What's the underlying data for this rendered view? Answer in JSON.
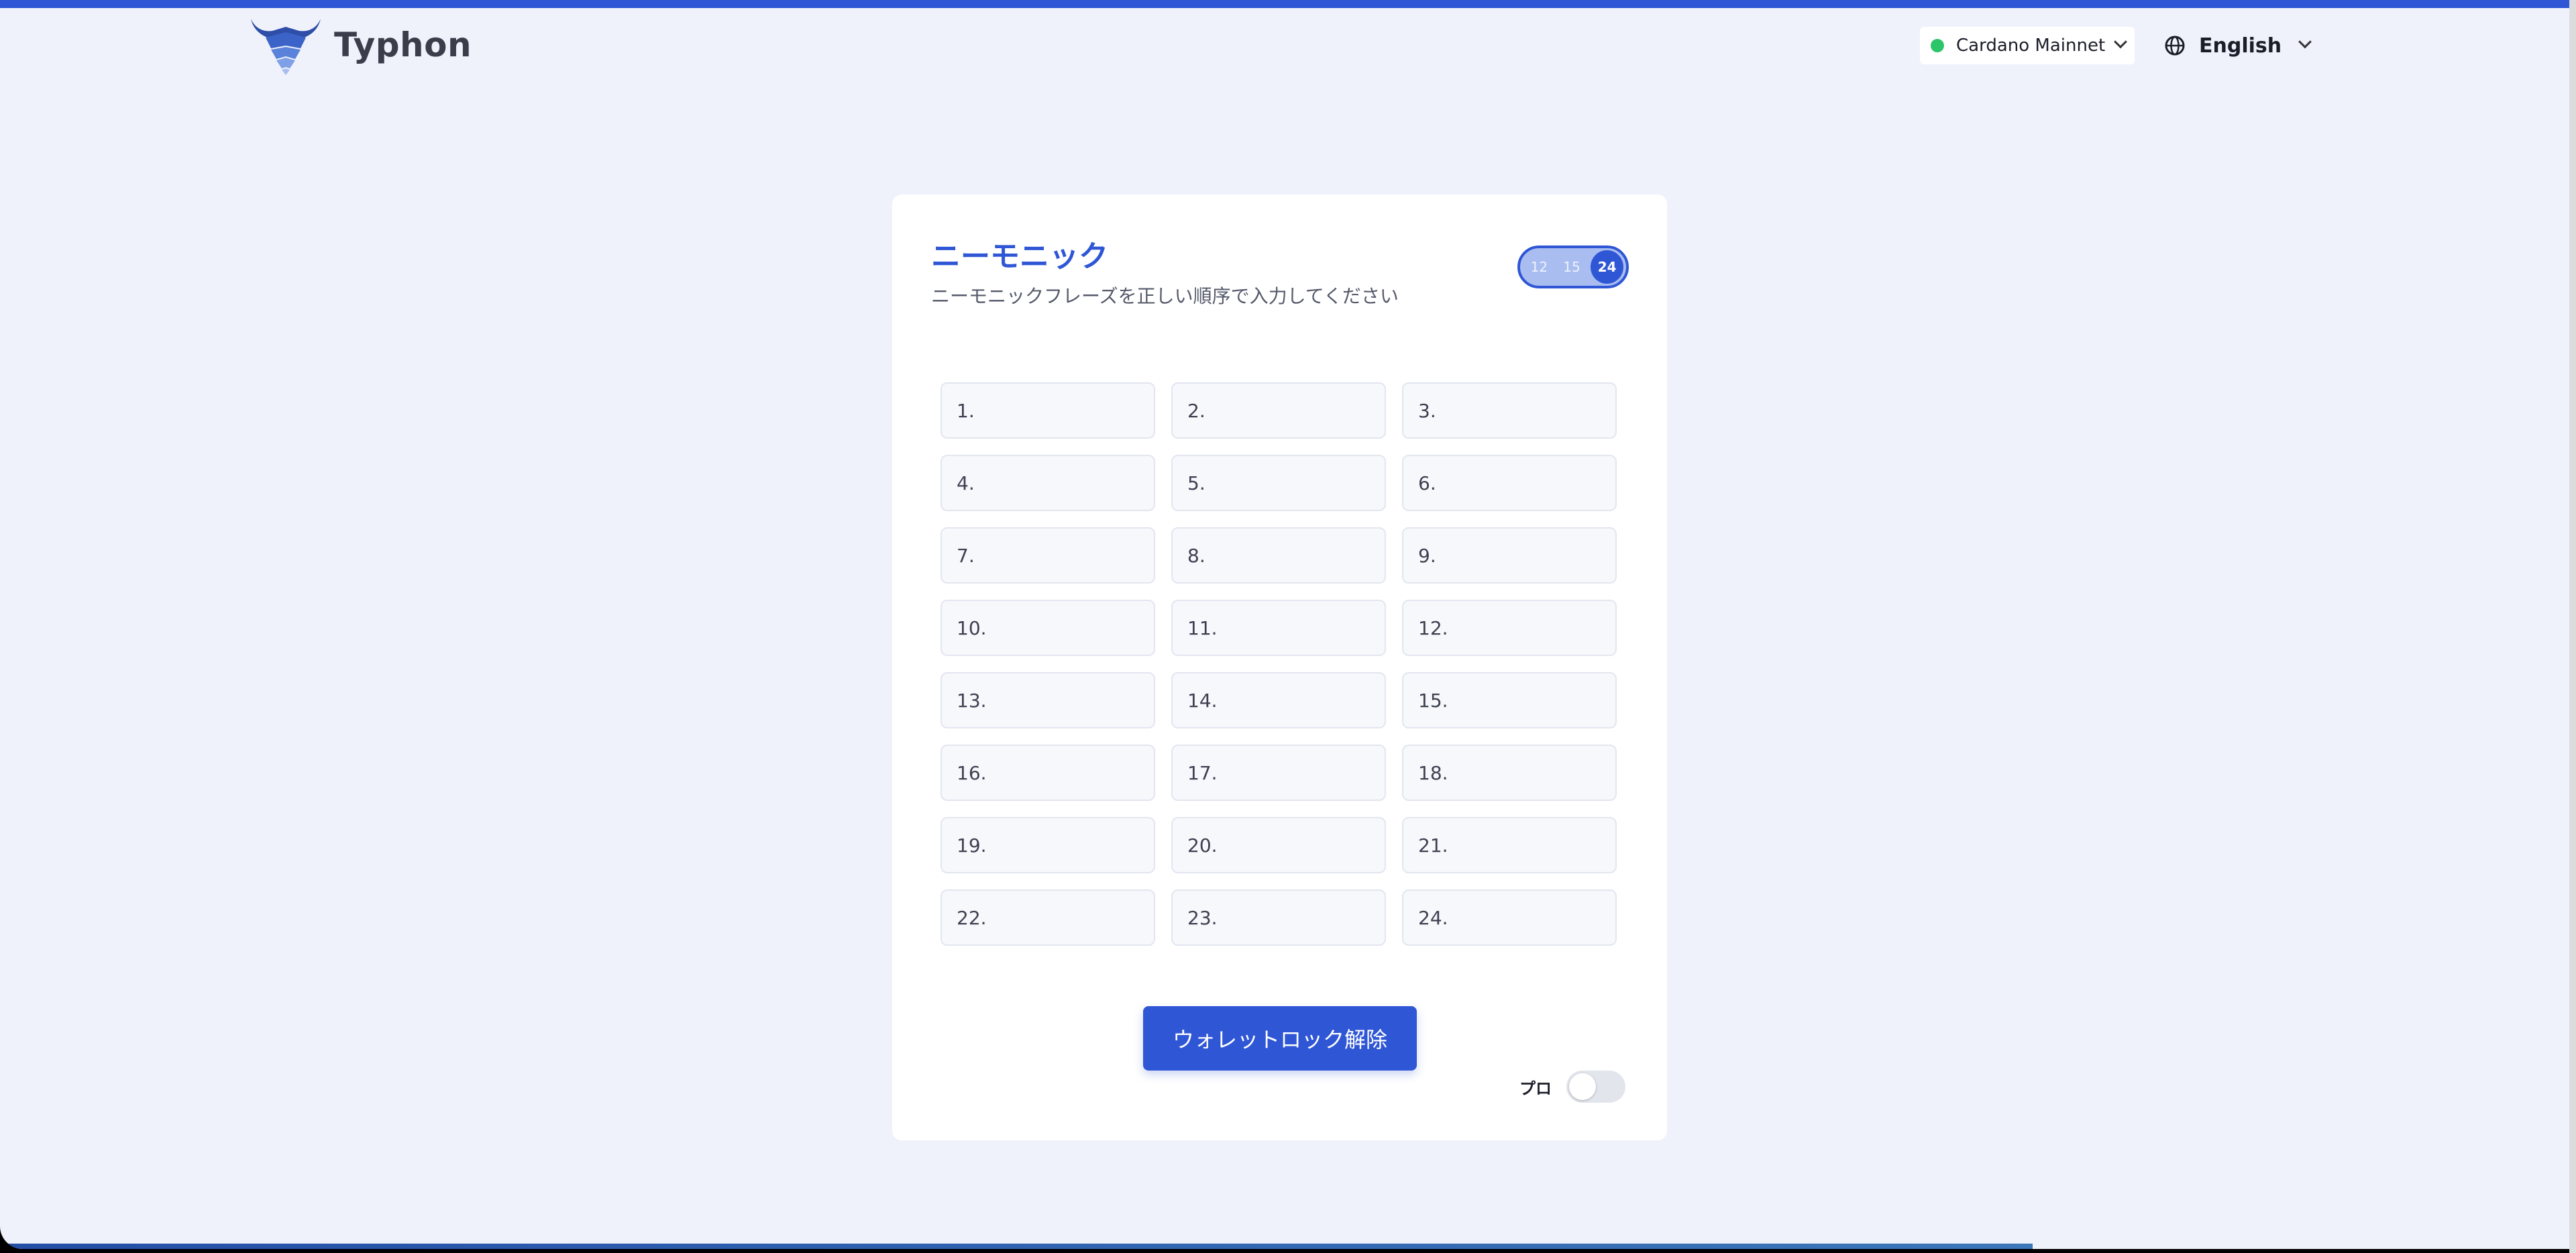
{
  "app": {
    "name": "Typhon"
  },
  "header": {
    "network": {
      "label": "Cardano Mainnet",
      "status_color": "#2dc56a"
    },
    "language": {
      "label": "English"
    }
  },
  "card": {
    "title": "ニーモニック",
    "subtitle": "ニーモニックフレーズを正しい順序で入力してください",
    "word_count_options": [
      "12",
      "15",
      "24"
    ],
    "selected_word_count": "24",
    "words": [
      "1.",
      "2.",
      "3.",
      "4.",
      "5.",
      "6.",
      "7.",
      "8.",
      "9.",
      "10.",
      "11.",
      "12.",
      "13.",
      "14.",
      "15.",
      "16.",
      "17.",
      "18.",
      "19.",
      "20.",
      "21.",
      "22.",
      "23.",
      "24."
    ],
    "unlock_button": "ウォレットロック解除",
    "pro_label": "プロ",
    "pro_enabled": false
  },
  "colors": {
    "accent": "#2f56d5",
    "background": "#eff2fb"
  },
  "icons": {
    "network_status": "status-dot-icon",
    "language": "globe-icon",
    "dropdown": "chevron-down-icon",
    "logo": "typhon-logo-icon"
  }
}
